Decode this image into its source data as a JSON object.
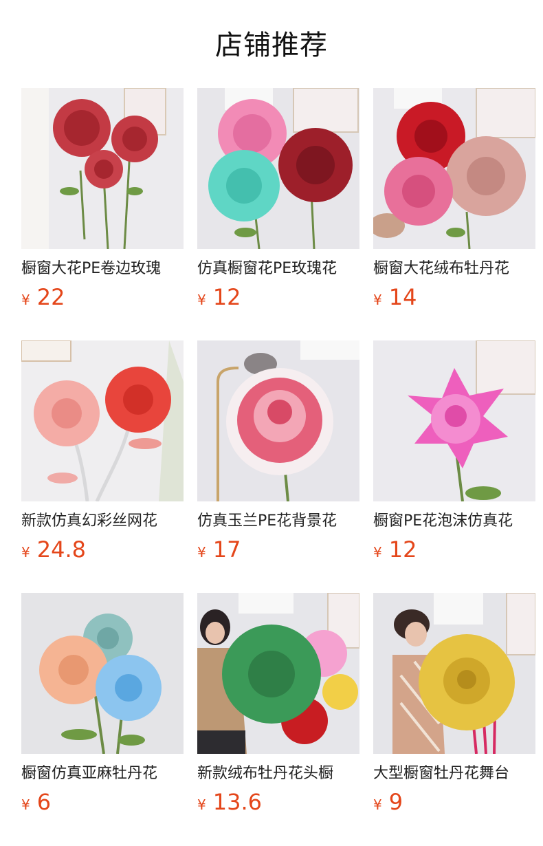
{
  "page_title": "店铺推荐",
  "colors": {
    "price": "#e4461a",
    "text": "#222222"
  },
  "products": [
    {
      "name": "橱窗大花PE卷边玫瑰",
      "currency": "¥",
      "price": "22",
      "image_icon": "red-roses-image"
    },
    {
      "name": "仿真橱窗花PE玫瑰花",
      "currency": "¥",
      "price": "12",
      "image_icon": "pink-teal-red-roses-image"
    },
    {
      "name": "橱窗大花绒布牡丹花",
      "currency": "¥",
      "price": "14",
      "image_icon": "red-pink-peonies-image"
    },
    {
      "name": "新款仿真幻彩丝网花",
      "currency": "¥",
      "price": "24.8",
      "image_icon": "coral-silk-flowers-image"
    },
    {
      "name": "仿真玉兰PE花背景花",
      "currency": "¥",
      "price": "17",
      "image_icon": "pink-white-magnolia-image"
    },
    {
      "name": "橱窗PE花泡沫仿真花",
      "currency": "¥",
      "price": "12",
      "image_icon": "pink-lotus-flower-image"
    },
    {
      "name": "橱窗仿真亚麻牡丹花",
      "currency": "¥",
      "price": "6",
      "image_icon": "linen-peonies-image"
    },
    {
      "name": "新款绒布牡丹花头橱",
      "currency": "¥",
      "price": "13.6",
      "image_icon": "woman-green-peony-image"
    },
    {
      "name": "大型橱窗牡丹花舞台",
      "currency": "¥",
      "price": "9",
      "image_icon": "woman-gold-peony-image"
    }
  ]
}
